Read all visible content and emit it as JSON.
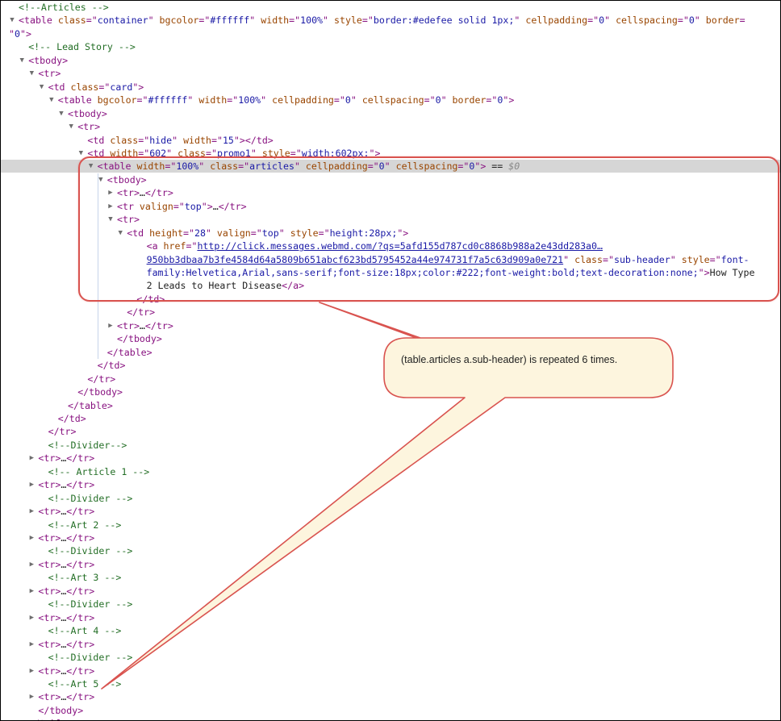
{
  "rows": [
    {
      "d": 0,
      "t": "",
      "parts": [
        [
          "cm",
          "<!--Articles -->"
        ]
      ]
    },
    {
      "d": 0,
      "t": "open",
      "parts": [
        [
          "tag",
          "<table "
        ],
        [
          "an",
          "class"
        ],
        [
          "tag",
          "=\""
        ],
        [
          "av",
          "container"
        ],
        [
          "tag",
          "\" "
        ],
        [
          "an",
          "bgcolor"
        ],
        [
          "tag",
          "=\""
        ],
        [
          "av",
          "#ffffff"
        ],
        [
          "tag",
          "\" "
        ],
        [
          "an",
          "width"
        ],
        [
          "tag",
          "=\""
        ],
        [
          "av",
          "100%"
        ],
        [
          "tag",
          "\" "
        ],
        [
          "an",
          "style"
        ],
        [
          "tag",
          "=\""
        ],
        [
          "av",
          "border:#edefee solid 1px;"
        ],
        [
          "tag",
          "\" "
        ],
        [
          "an",
          "cellpadding"
        ],
        [
          "tag",
          "=\""
        ],
        [
          "av",
          "0"
        ],
        [
          "tag",
          "\" "
        ],
        [
          "an",
          "cellspacing"
        ],
        [
          "tag",
          "=\""
        ],
        [
          "av",
          "0"
        ],
        [
          "tag",
          "\" "
        ],
        [
          "an",
          "border"
        ],
        [
          "tag",
          "="
        ]
      ]
    },
    {
      "d": -1,
      "t": "",
      "parts": [
        [
          "tag",
          "\""
        ],
        [
          "av",
          "0"
        ],
        [
          "tag",
          "\">"
        ]
      ]
    },
    {
      "d": 1,
      "t": "",
      "parts": [
        [
          "cm",
          "<!-- Lead Story -->"
        ]
      ]
    },
    {
      "d": 1,
      "t": "open",
      "parts": [
        [
          "tag",
          "<tbody>"
        ]
      ]
    },
    {
      "d": 2,
      "t": "open",
      "parts": [
        [
          "tag",
          "<tr>"
        ]
      ]
    },
    {
      "d": 3,
      "t": "open",
      "parts": [
        [
          "tag",
          "<td "
        ],
        [
          "an",
          "class"
        ],
        [
          "tag",
          "=\""
        ],
        [
          "av",
          "card"
        ],
        [
          "tag",
          "\">"
        ]
      ]
    },
    {
      "d": 4,
      "t": "open",
      "parts": [
        [
          "tag",
          "<table "
        ],
        [
          "an",
          "bgcolor"
        ],
        [
          "tag",
          "=\""
        ],
        [
          "av",
          "#ffffff"
        ],
        [
          "tag",
          "\" "
        ],
        [
          "an",
          "width"
        ],
        [
          "tag",
          "=\""
        ],
        [
          "av",
          "100%"
        ],
        [
          "tag",
          "\" "
        ],
        [
          "an",
          "cellpadding"
        ],
        [
          "tag",
          "=\""
        ],
        [
          "av",
          "0"
        ],
        [
          "tag",
          "\" "
        ],
        [
          "an",
          "cellspacing"
        ],
        [
          "tag",
          "=\""
        ],
        [
          "av",
          "0"
        ],
        [
          "tag",
          "\" "
        ],
        [
          "an",
          "border"
        ],
        [
          "tag",
          "=\""
        ],
        [
          "av",
          "0"
        ],
        [
          "tag",
          "\">"
        ]
      ]
    },
    {
      "d": 5,
      "t": "open",
      "parts": [
        [
          "tag",
          "<tbody>"
        ]
      ]
    },
    {
      "d": 6,
      "t": "open",
      "parts": [
        [
          "tag",
          "<tr>"
        ]
      ]
    },
    {
      "d": 7,
      "t": "",
      "parts": [
        [
          "tag",
          "<td "
        ],
        [
          "an",
          "class"
        ],
        [
          "tag",
          "=\""
        ],
        [
          "av",
          "hide"
        ],
        [
          "tag",
          "\" "
        ],
        [
          "an",
          "width"
        ],
        [
          "tag",
          "=\""
        ],
        [
          "av",
          "15"
        ],
        [
          "tag",
          "\"></td>"
        ]
      ]
    },
    {
      "d": 7,
      "t": "open",
      "parts": [
        [
          "tag",
          "<td "
        ],
        [
          "an",
          "width"
        ],
        [
          "tag",
          "=\""
        ],
        [
          "av",
          "602"
        ],
        [
          "tag",
          "\" "
        ],
        [
          "an",
          "class"
        ],
        [
          "tag",
          "=\""
        ],
        [
          "av",
          "promo1"
        ],
        [
          "tag",
          "\" "
        ],
        [
          "an",
          "style"
        ],
        [
          "tag",
          "=\""
        ],
        [
          "av",
          "width:602px;"
        ],
        [
          "tag",
          "\">"
        ]
      ]
    },
    {
      "d": 8,
      "t": "open",
      "sel": true,
      "parts": [
        [
          "tag",
          "<table "
        ],
        [
          "an",
          "width"
        ],
        [
          "tag",
          "=\""
        ],
        [
          "av",
          "100%"
        ],
        [
          "tag",
          "\" "
        ],
        [
          "an",
          "class"
        ],
        [
          "tag",
          "=\""
        ],
        [
          "av",
          "articles"
        ],
        [
          "tag",
          "\" "
        ],
        [
          "an",
          "cellpadding"
        ],
        [
          "tag",
          "=\""
        ],
        [
          "av",
          "0"
        ],
        [
          "tag",
          "\" "
        ],
        [
          "an",
          "cellspacing"
        ],
        [
          "tag",
          "=\""
        ],
        [
          "av",
          "0"
        ],
        [
          "tag",
          "\">"
        ],
        [
          "tx",
          " == "
        ],
        [
          "dl",
          "$0"
        ]
      ]
    },
    {
      "d": 9,
      "t": "open",
      "parts": [
        [
          "tag",
          "<tbody>"
        ]
      ]
    },
    {
      "d": 10,
      "t": "closed",
      "parts": [
        [
          "tag",
          "<tr>"
        ],
        [
          "tx",
          "…"
        ],
        [
          "tag",
          "</tr>"
        ]
      ]
    },
    {
      "d": 10,
      "t": "closed",
      "parts": [
        [
          "tag",
          "<tr "
        ],
        [
          "an",
          "valign"
        ],
        [
          "tag",
          "=\""
        ],
        [
          "av",
          "top"
        ],
        [
          "tag",
          "\">"
        ],
        [
          "tx",
          "…"
        ],
        [
          "tag",
          "</tr>"
        ]
      ]
    },
    {
      "d": 10,
      "t": "open",
      "parts": [
        [
          "tag",
          "<tr>"
        ]
      ]
    },
    {
      "d": 11,
      "t": "open",
      "parts": [
        [
          "tag",
          "<td "
        ],
        [
          "an",
          "height"
        ],
        [
          "tag",
          "=\""
        ],
        [
          "av",
          "28"
        ],
        [
          "tag",
          "\" "
        ],
        [
          "an",
          "valign"
        ],
        [
          "tag",
          "=\""
        ],
        [
          "av",
          "top"
        ],
        [
          "tag",
          "\" "
        ],
        [
          "an",
          "style"
        ],
        [
          "tag",
          "=\""
        ],
        [
          "av",
          "height:28px;"
        ],
        [
          "tag",
          "\">"
        ]
      ]
    },
    {
      "d": 13,
      "t": "",
      "parts": [
        [
          "tag",
          "<a "
        ],
        [
          "an",
          "href"
        ],
        [
          "tag",
          "=\""
        ],
        [
          "lk",
          "http://click.messages.webmd.com/?qs=5afd155d787cd0c8868b988a2e43dd283a0…"
        ]
      ]
    },
    {
      "d": 13,
      "t": "",
      "parts": [
        [
          "lk",
          "950bb3dbaa7b3fe4584d64a5809b651abcf623bd5795452a44e974731f7a5c63d909a0e721"
        ],
        [
          "tag",
          "\" "
        ],
        [
          "an",
          "class"
        ],
        [
          "tag",
          "=\""
        ],
        [
          "av",
          "sub-header"
        ],
        [
          "tag",
          "\" "
        ],
        [
          "an",
          "style"
        ],
        [
          "tag",
          "=\""
        ],
        [
          "av",
          "font-"
        ]
      ]
    },
    {
      "d": 13,
      "t": "",
      "parts": [
        [
          "av",
          "family:Helvetica,Arial,sans-serif;font-size:18px;color:#222;font-weight:bold;text-decoration:none;"
        ],
        [
          "tag",
          "\">"
        ],
        [
          "tx",
          "How Type"
        ]
      ]
    },
    {
      "d": 13,
      "t": "",
      "parts": [
        [
          "tx",
          "2 Leads to Heart Disease"
        ],
        [
          "tag",
          "</a>"
        ]
      ]
    },
    {
      "d": 12,
      "t": "",
      "parts": [
        [
          "tag",
          "</td>"
        ]
      ]
    },
    {
      "d": 11,
      "t": "",
      "parts": [
        [
          "tag",
          "</tr>"
        ]
      ]
    },
    {
      "d": 10,
      "t": "closed",
      "parts": [
        [
          "tag",
          "<tr>"
        ],
        [
          "tx",
          "…"
        ],
        [
          "tag",
          "</tr>"
        ]
      ]
    },
    {
      "d": 10,
      "t": "",
      "parts": [
        [
          "tag",
          "</tbody>"
        ]
      ]
    },
    {
      "d": 9,
      "t": "",
      "parts": [
        [
          "tag",
          "</table>"
        ]
      ]
    },
    {
      "d": 8,
      "t": "",
      "parts": [
        [
          "tag",
          "</td>"
        ]
      ]
    },
    {
      "d": 7,
      "t": "",
      "parts": [
        [
          "tag",
          "</tr>"
        ]
      ]
    },
    {
      "d": 6,
      "t": "",
      "parts": [
        [
          "tag",
          "</tbody>"
        ]
      ]
    },
    {
      "d": 5,
      "t": "",
      "parts": [
        [
          "tag",
          "</table>"
        ]
      ]
    },
    {
      "d": 4,
      "t": "",
      "parts": [
        [
          "tag",
          "</td>"
        ]
      ]
    },
    {
      "d": 3,
      "t": "",
      "parts": [
        [
          "tag",
          "</tr>"
        ]
      ]
    },
    {
      "d": 3,
      "t": "",
      "parts": [
        [
          "cm",
          "<!--Divider-->"
        ]
      ]
    },
    {
      "d": 2,
      "t": "closed",
      "parts": [
        [
          "tag",
          "<tr>"
        ],
        [
          "tx",
          "…"
        ],
        [
          "tag",
          "</tr>"
        ]
      ]
    },
    {
      "d": 3,
      "t": "",
      "parts": [
        [
          "cm",
          "<!-- Article 1 -->"
        ]
      ]
    },
    {
      "d": 2,
      "t": "closed",
      "parts": [
        [
          "tag",
          "<tr>"
        ],
        [
          "tx",
          "…"
        ],
        [
          "tag",
          "</tr>"
        ]
      ]
    },
    {
      "d": 3,
      "t": "",
      "parts": [
        [
          "cm",
          "<!--Divider -->"
        ]
      ]
    },
    {
      "d": 2,
      "t": "closed",
      "parts": [
        [
          "tag",
          "<tr>"
        ],
        [
          "tx",
          "…"
        ],
        [
          "tag",
          "</tr>"
        ]
      ]
    },
    {
      "d": 3,
      "t": "",
      "parts": [
        [
          "cm",
          "<!--Art 2 -->"
        ]
      ]
    },
    {
      "d": 2,
      "t": "closed",
      "parts": [
        [
          "tag",
          "<tr>"
        ],
        [
          "tx",
          "…"
        ],
        [
          "tag",
          "</tr>"
        ]
      ]
    },
    {
      "d": 3,
      "t": "",
      "parts": [
        [
          "cm",
          "<!--Divider -->"
        ]
      ]
    },
    {
      "d": 2,
      "t": "closed",
      "parts": [
        [
          "tag",
          "<tr>"
        ],
        [
          "tx",
          "…"
        ],
        [
          "tag",
          "</tr>"
        ]
      ]
    },
    {
      "d": 3,
      "t": "",
      "parts": [
        [
          "cm",
          "<!--Art 3 -->"
        ]
      ]
    },
    {
      "d": 2,
      "t": "closed",
      "parts": [
        [
          "tag",
          "<tr>"
        ],
        [
          "tx",
          "…"
        ],
        [
          "tag",
          "</tr>"
        ]
      ]
    },
    {
      "d": 3,
      "t": "",
      "parts": [
        [
          "cm",
          "<!--Divider -->"
        ]
      ]
    },
    {
      "d": 2,
      "t": "closed",
      "parts": [
        [
          "tag",
          "<tr>"
        ],
        [
          "tx",
          "…"
        ],
        [
          "tag",
          "</tr>"
        ]
      ]
    },
    {
      "d": 3,
      "t": "",
      "parts": [
        [
          "cm",
          "<!--Art 4 -->"
        ]
      ]
    },
    {
      "d": 2,
      "t": "closed",
      "parts": [
        [
          "tag",
          "<tr>"
        ],
        [
          "tx",
          "…"
        ],
        [
          "tag",
          "</tr>"
        ]
      ]
    },
    {
      "d": 3,
      "t": "",
      "parts": [
        [
          "cm",
          "<!--Divider -->"
        ]
      ]
    },
    {
      "d": 2,
      "t": "closed",
      "parts": [
        [
          "tag",
          "<tr>"
        ],
        [
          "tx",
          "…"
        ],
        [
          "tag",
          "</tr>"
        ]
      ]
    },
    {
      "d": 3,
      "t": "",
      "parts": [
        [
          "cm",
          "<!--Art 5 -->"
        ]
      ]
    },
    {
      "d": 2,
      "t": "closed",
      "parts": [
        [
          "tag",
          "<tr>"
        ],
        [
          "tx",
          "…"
        ],
        [
          "tag",
          "</tr>"
        ]
      ]
    },
    {
      "d": 2,
      "t": "",
      "parts": [
        [
          "tag",
          "</tbody>"
        ]
      ]
    },
    {
      "d": 1,
      "t": "",
      "parts": [
        [
          "tag",
          "</table>"
        ]
      ]
    }
  ],
  "callout": {
    "text": "(table.articles a.sub-header) is repeated 6 times."
  },
  "colors": {
    "tag": "#881280",
    "attr_name": "#994500",
    "attr_value": "#1a1aa6",
    "comment": "#236e25",
    "highlight": "#d9534f",
    "callout_fill": "#fdf5de",
    "selected_row": "#d6d6d6"
  }
}
